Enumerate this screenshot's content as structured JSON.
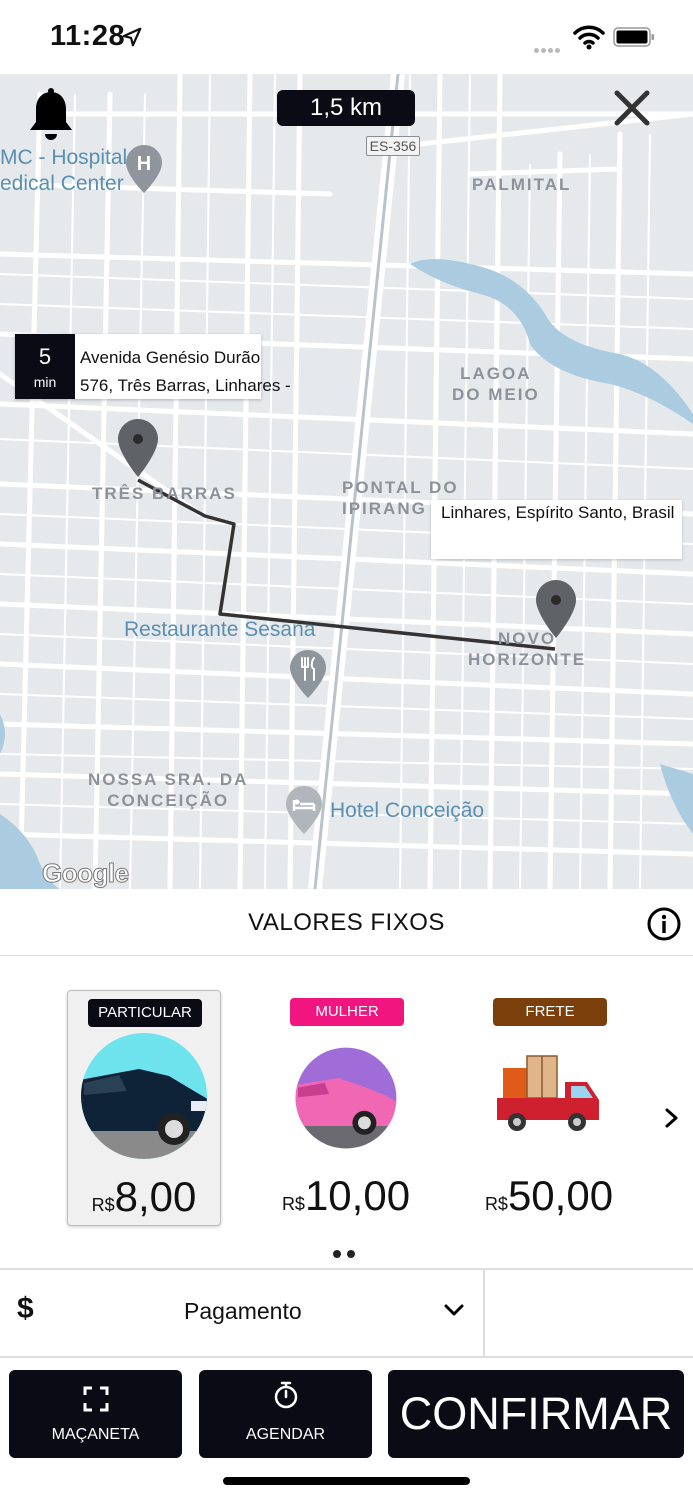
{
  "status_bar": {
    "time": "11:28"
  },
  "map": {
    "distance": "1,5 km",
    "road_badge": "ES-356",
    "labels": {
      "hospital": "MC - Hospital\nedical Center",
      "palmital": "PALMITAL",
      "lagoa": "LAGOA\nDO MEIO",
      "tres_barras": "TRÊS BARRAS",
      "pontal": "PONTAL DO\nIPIRANG",
      "restaurante": "Restaurante Sesana",
      "novo_horizonte": "NOVO\nHORIZONTE",
      "nossa_sra": "NOSSA SRA. DA\nCONCEIÇÃO",
      "hotel": "Hotel Conceição",
      "google": "Google"
    },
    "origin": {
      "eta_value": "5",
      "eta_unit": "min",
      "address_line1": "Avenida Genésio Durão",
      "address_line2": "576, Três Barras, Linhares -"
    },
    "destination": {
      "address": "Linhares, Espírito Santo, Brasil"
    }
  },
  "panel": {
    "title": "VALORES FIXOS",
    "categories": [
      {
        "tag": "PARTICULAR",
        "currency": "R$",
        "price": "8,00",
        "tag_color": "#0b0b15"
      },
      {
        "tag": "MULHER",
        "currency": "R$",
        "price": "10,00",
        "tag_color": "#f0157f"
      },
      {
        "tag": "FRETE",
        "currency": "R$",
        "price": "50,00",
        "tag_color": "#7a3f0a"
      }
    ]
  },
  "payment": {
    "symbol": "$",
    "label": "Pagamento"
  },
  "actions": {
    "macaneta": "MAÇANETA",
    "agendar": "AGENDAR",
    "confirmar": "CONFIRMAR"
  }
}
